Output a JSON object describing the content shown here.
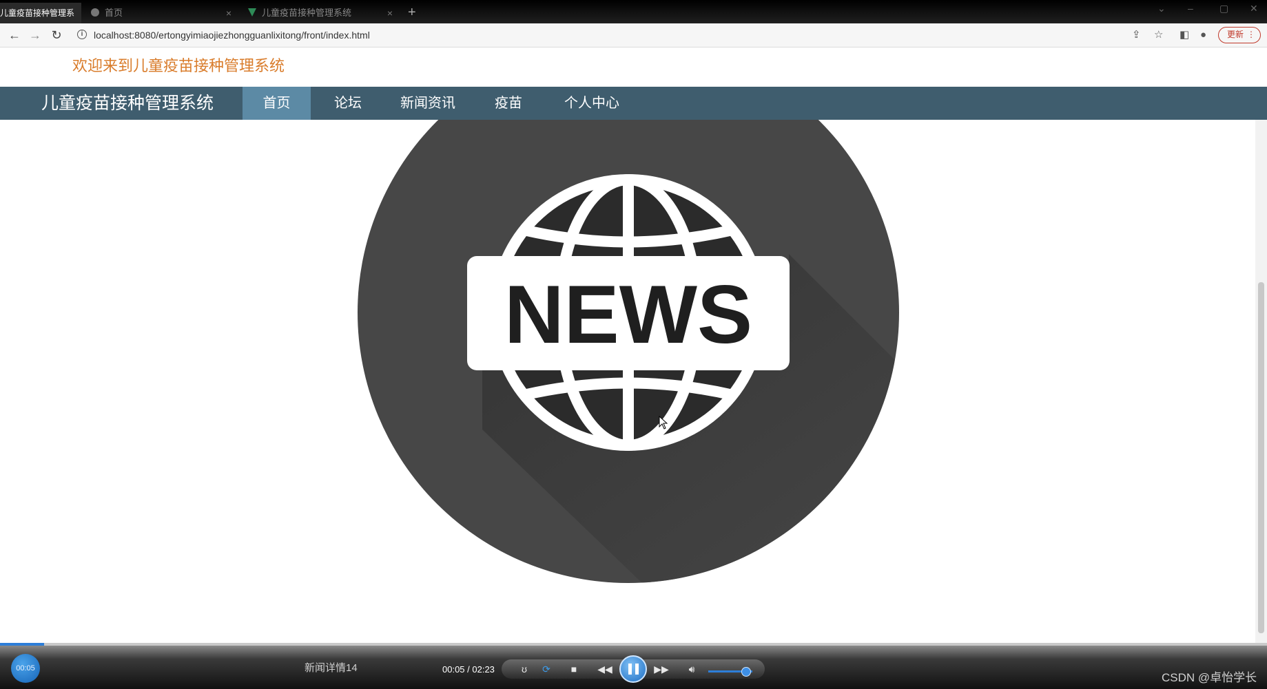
{
  "browser": {
    "tabs": [
      {
        "title": "儿童疫苗接种管理系统",
        "active": true
      },
      {
        "title": "首页",
        "active": false
      },
      {
        "title": "儿童疫苗接种管理系统",
        "active": false
      }
    ],
    "tab_close_glyph": "×",
    "new_tab_glyph": "+",
    "url": "localhost:8080/ertongyimiaojiezhongguanlixitong/front/index.html",
    "update_label": "更新",
    "icons": [
      "back-icon",
      "forward-icon",
      "reload-icon",
      "info-icon",
      "share-icon",
      "star-icon",
      "sidepanel-icon",
      "profile-icon",
      "menu-icon"
    ]
  },
  "page": {
    "welcome_text": "欢迎来到儿童疫苗接种管理系统",
    "site_title": "儿童疫苗接种管理系统",
    "nav": [
      {
        "label": "首页",
        "active": true
      },
      {
        "label": "论坛",
        "active": false
      },
      {
        "label": "新闻资讯",
        "active": false
      },
      {
        "label": "疫苗",
        "active": false
      },
      {
        "label": "个人中心",
        "active": false
      }
    ],
    "banner_text": "NEWS",
    "colors": {
      "welcome": "#d97c2b",
      "navbar": "#3f5d6e",
      "nav_active": "#5c8aa5",
      "news_circle": "#474747"
    }
  },
  "player": {
    "current_time_bubble": "00:05",
    "title": "新闻详情14",
    "time_display": "00:05 / 02:23",
    "progress": 0.035,
    "volume": 0.85,
    "watermark": "CSDN @卓怡学长"
  }
}
